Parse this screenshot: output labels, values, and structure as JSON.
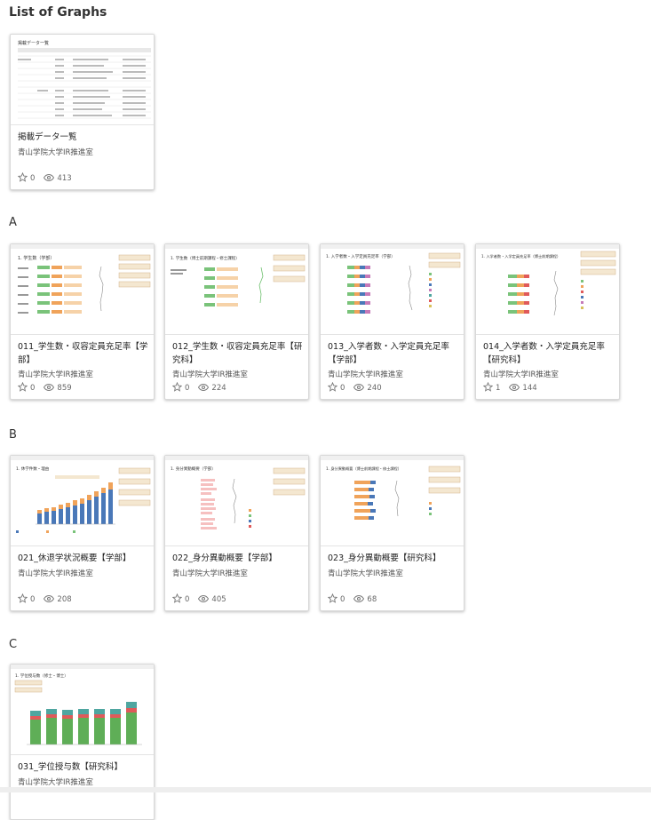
{
  "page": {
    "title": "List of Graphs"
  },
  "sections": [
    {
      "title": "",
      "cards": [
        {
          "title": "掲載データ一覧",
          "author": "青山学院大学IR推進室",
          "favorites": "0",
          "views": "413",
          "thumb_label": "掲載データ一覧"
        }
      ]
    },
    {
      "title": "A",
      "cards": [
        {
          "title": "011_学生数・収容定員充足率【学部】",
          "author": "青山学院大学IR推進室",
          "favorites": "0",
          "views": "859",
          "thumb_label": "1. 学生数（学部）"
        },
        {
          "title": "012_学生数・収容定員充足率【研究科】",
          "author": "青山学院大学IR推進室",
          "favorites": "0",
          "views": "224",
          "thumb_label": "1. 学生数（博士前期課程・修士課程）"
        },
        {
          "title": "013_入学者数・入学定員充足率【学部】",
          "author": "青山学院大学IR推進室",
          "favorites": "0",
          "views": "240",
          "thumb_label": "1. 入学者数・入学定員充足率（学部）"
        },
        {
          "title": "014_入学者数・入学定員充足率【研究科】",
          "author": "青山学院大学IR推進室",
          "favorites": "1",
          "views": "144",
          "thumb_label": "1. 入学者数・入学定員充足率（博士前期課程）"
        }
      ]
    },
    {
      "title": "B",
      "cards": [
        {
          "title": "021_休退学状況概要【学部】",
          "author": "青山学院大学IR推進室",
          "favorites": "0",
          "views": "208",
          "thumb_label": "1. 休学件数・理由"
        },
        {
          "title": "022_身分異動概要【学部】",
          "author": "青山学院大学IR推進室",
          "favorites": "0",
          "views": "405",
          "thumb_label": "1. 身分異動概要（学部）"
        },
        {
          "title": "023_身分異動概要【研究科】",
          "author": "青山学院大学IR推進室",
          "favorites": "0",
          "views": "68",
          "thumb_label": "1. 身分異動概要（博士前期課程・修士課程）"
        }
      ]
    },
    {
      "title": "C",
      "cards": [
        {
          "title": "031_学位授与数【研究科】",
          "author": "青山学院大学IR推進室",
          "favorites": "",
          "views": "",
          "thumb_label": "1. 学位授与数（修士・博士）"
        }
      ]
    }
  ],
  "icons": {
    "favorite": "star-outline-icon",
    "views": "eye-icon"
  },
  "colors": {
    "accent_orange": "#f0a35a",
    "accent_green": "#5fae57",
    "accent_blue": "#4a78b8",
    "accent_teal": "#4fa6a0"
  }
}
